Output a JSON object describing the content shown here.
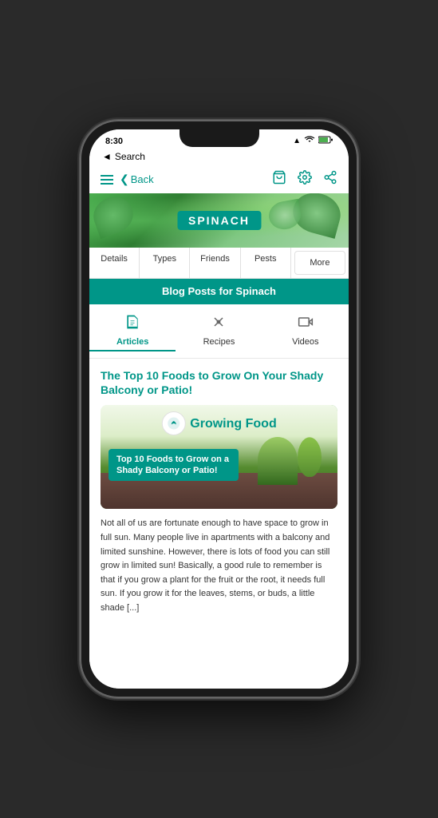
{
  "phone": {
    "status_bar": {
      "time": "8:30",
      "signal_icon": "▲",
      "wifi_icon": "wifi",
      "battery_icon": "battery"
    }
  },
  "nav": {
    "back_label": "Search",
    "back_page_label": "Back",
    "cart_icon": "cart-icon",
    "settings_icon": "settings-icon",
    "share_icon": "share-icon"
  },
  "hero": {
    "title": "SPINACH"
  },
  "tabs": [
    {
      "label": "Details",
      "active": false
    },
    {
      "label": "Types",
      "active": false
    },
    {
      "label": "Friends",
      "active": false
    },
    {
      "label": "Pests",
      "active": false
    },
    {
      "label": "More",
      "active": true
    }
  ],
  "blog_header": {
    "text": "Blog Posts for Spinach"
  },
  "content_tabs": [
    {
      "label": "Articles",
      "icon": "📖",
      "active": true
    },
    {
      "label": "Recipes",
      "icon": "✂",
      "active": false
    },
    {
      "label": "Videos",
      "icon": "📹",
      "active": false
    }
  ],
  "article": {
    "title": "The Top 10 Foods to Grow On Your Shady Balcony or Patio!",
    "growing_food_label": "Growing Food",
    "overlay_text": "Top 10 Foods to Grow on a Shady Balcony or Patio!",
    "body": "Not all of us are fortunate enough to have space to grow in full sun. Many people live in apartments with a balcony and limited sunshine. However, there is lots of food you can still  grow in limited sun! Basically, a good rule to remember is that if you grow a plant for the fruit or the root, it needs full sun. If you grow it for the leaves, stems, or buds, a little shade [...]"
  }
}
